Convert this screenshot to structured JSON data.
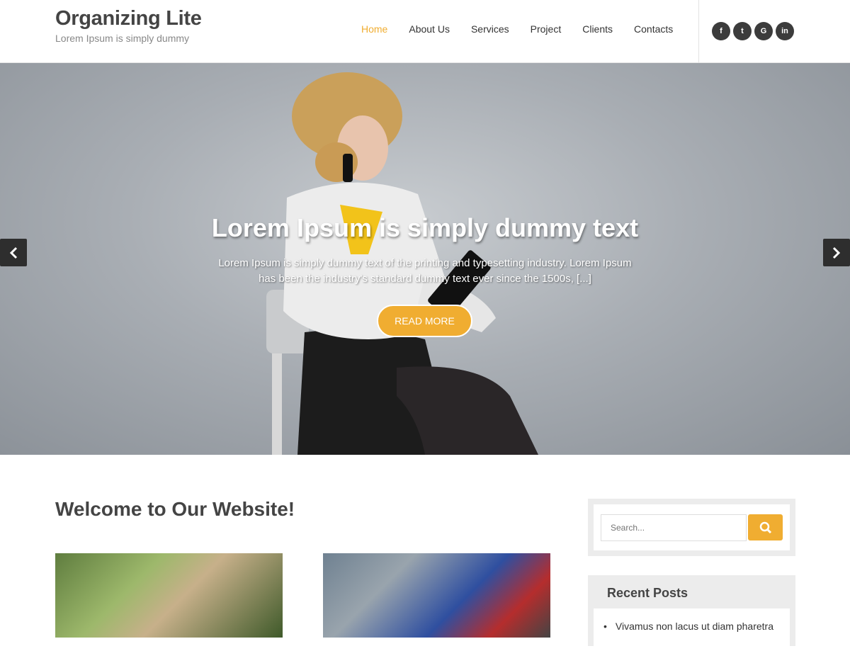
{
  "header": {
    "site_title": "Organizing Lite",
    "site_tagline": "Lorem Ipsum is simply dummy",
    "nav": [
      {
        "label": "Home",
        "active": true
      },
      {
        "label": "About Us"
      },
      {
        "label": "Services"
      },
      {
        "label": "Project"
      },
      {
        "label": "Clients"
      },
      {
        "label": "Contacts"
      }
    ],
    "social": [
      {
        "icon": "facebook-icon",
        "glyph": "f"
      },
      {
        "icon": "twitter-icon",
        "glyph": "t"
      },
      {
        "icon": "google-plus-icon",
        "glyph": "G"
      },
      {
        "icon": "linkedin-icon",
        "glyph": "in"
      }
    ]
  },
  "hero": {
    "title": "Lorem Ipsum is simply dummy text",
    "text": "Lorem Ipsum is simply dummy text of the printing and typesetting industry. Lorem Ipsum has been the industry's standard dummy text ever since the 1500s, [...]",
    "button_label": "READ MORE",
    "prev_icon": "chevron-left-icon",
    "next_icon": "chevron-right-icon"
  },
  "main": {
    "welcome_heading": "Welcome to Our Website!"
  },
  "sidebar": {
    "search_placeholder": "Search...",
    "search_icon": "search-icon",
    "recent_title": "Recent Posts",
    "recent_posts": [
      "Vivamus non lacus ut diam pharetra"
    ]
  },
  "colors": {
    "accent": "#f0ad31",
    "dark": "#3c3c3c",
    "heading": "#444444"
  }
}
